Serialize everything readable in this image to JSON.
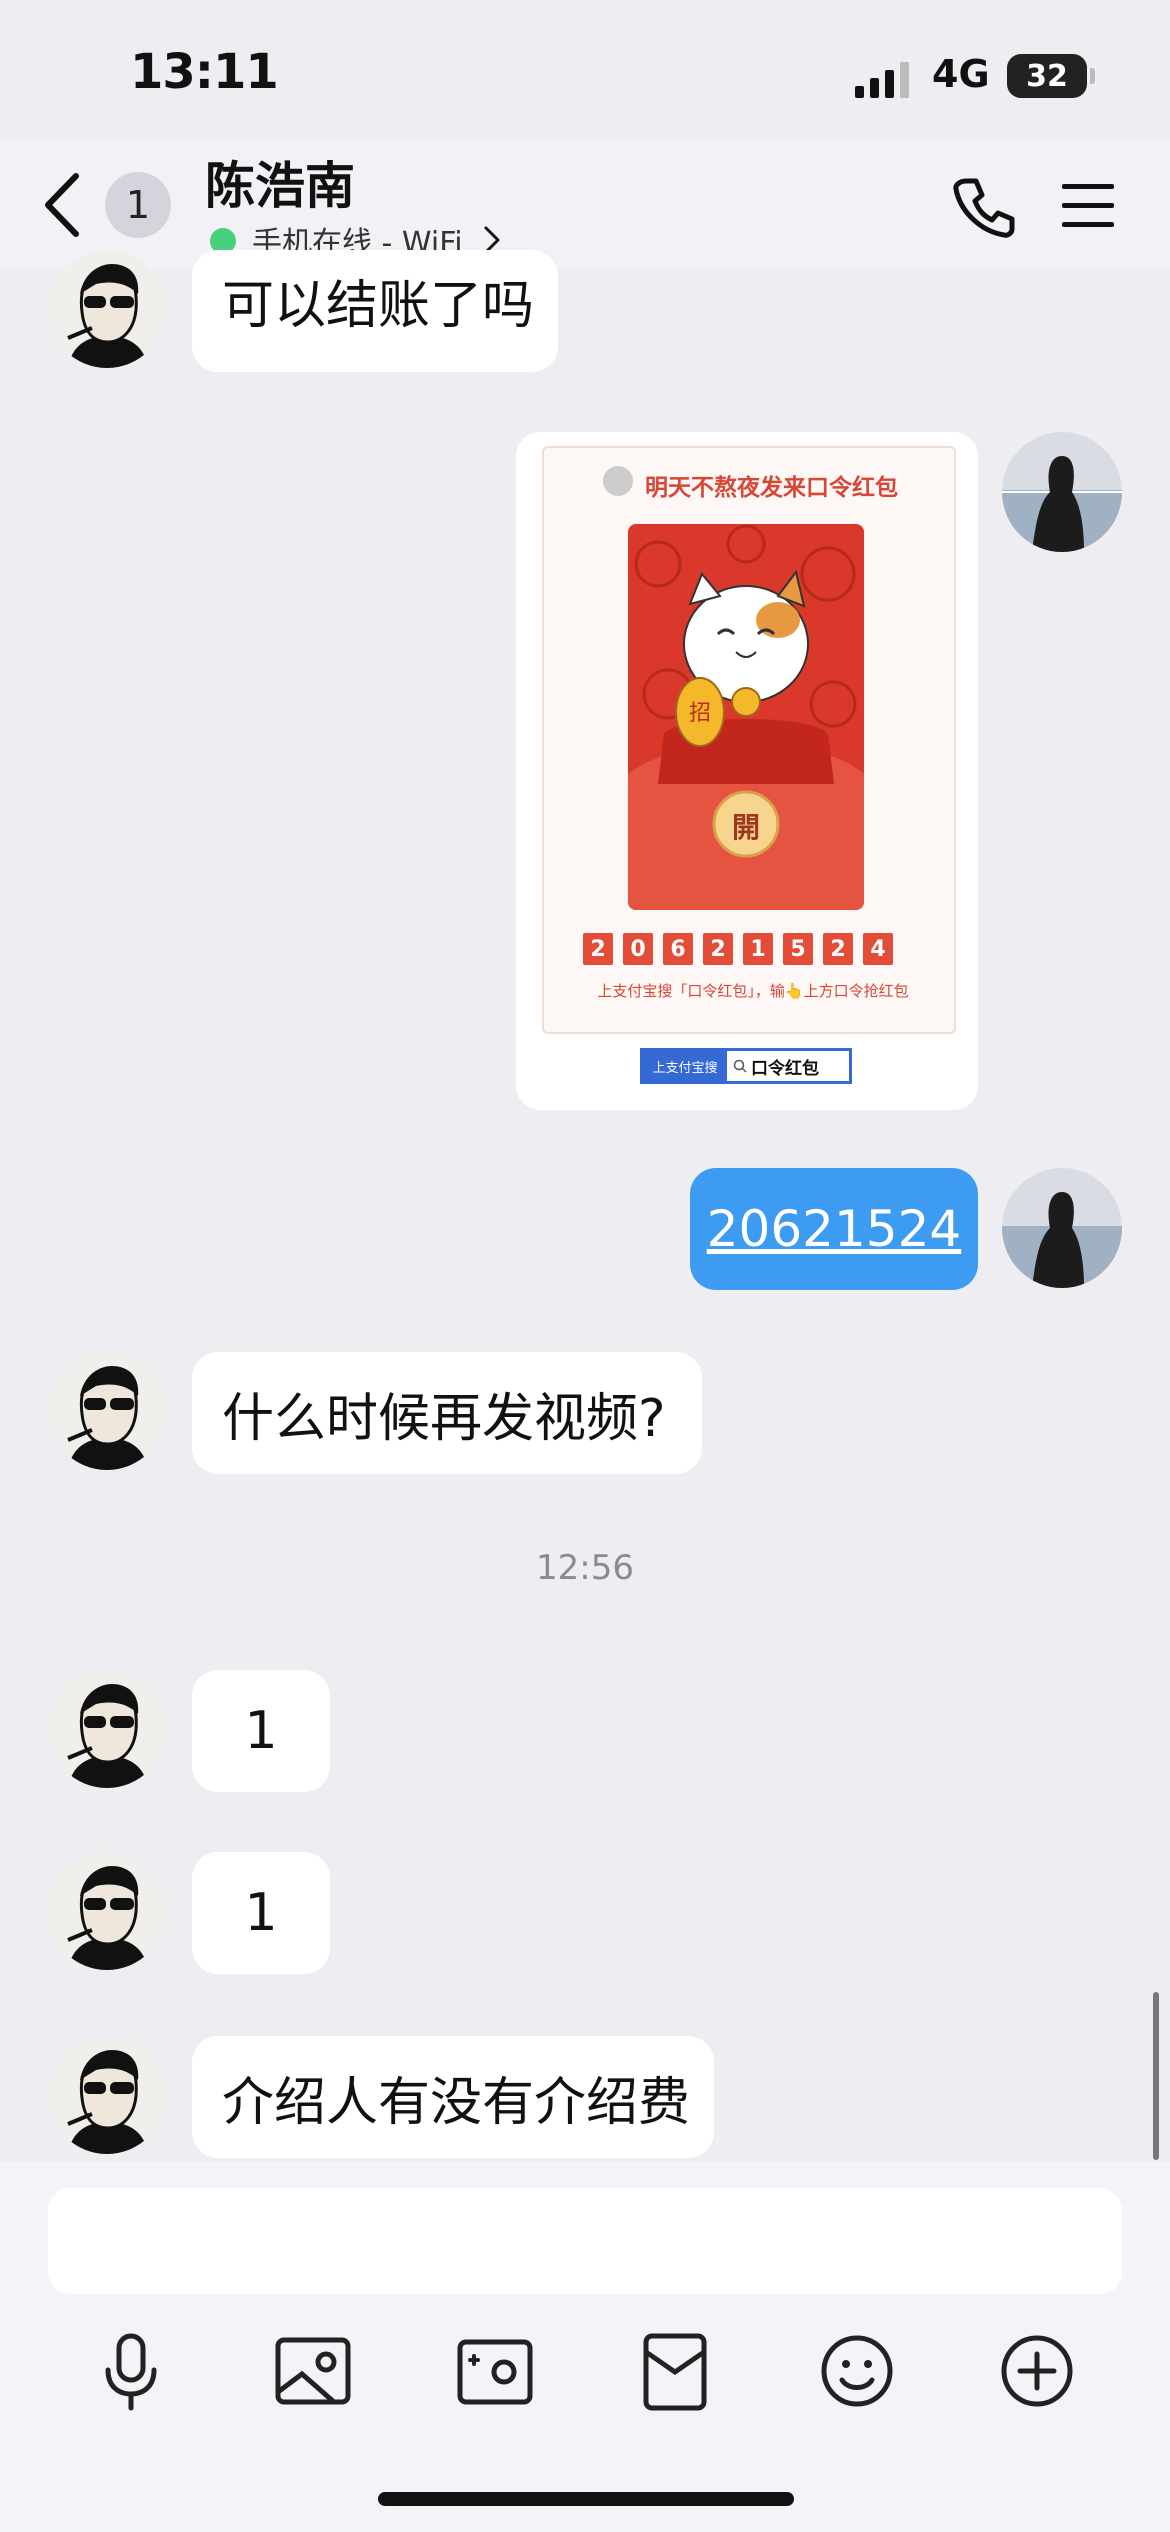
{
  "status_bar": {
    "time": "13:11",
    "network": "4G",
    "battery": "32"
  },
  "header": {
    "unread_count": "1",
    "contact_name": "陈浩南",
    "online_status": "手机在线 - WiFi"
  },
  "messages": [
    {
      "sender": "contact",
      "text": "可以结账了吗"
    },
    {
      "sender": "me",
      "type": "red_envelope_image",
      "title": "明天不熬夜发来口令红包",
      "seal": "開",
      "code_digits": [
        "2",
        "0",
        "6",
        "2",
        "1",
        "5",
        "2",
        "4"
      ],
      "instruction": "上支付宝搜「口令红包」，输👆上方口令抢红包",
      "search_label": "上支付宝搜",
      "search_term": "口令红包"
    },
    {
      "sender": "me",
      "text": "20621524"
    },
    {
      "sender": "contact",
      "text": "什么时候再发视频?"
    },
    {
      "sender": "contact",
      "text": "1"
    },
    {
      "sender": "contact",
      "text": "1"
    },
    {
      "sender": "contact",
      "text": "介绍人有没有介绍费"
    }
  ],
  "time_divider": "12:56",
  "input": {
    "placeholder": ""
  },
  "toolbar": [
    "mic-icon",
    "image-icon",
    "camera-icon",
    "red-packet-icon",
    "emoji-icon",
    "plus-icon"
  ]
}
